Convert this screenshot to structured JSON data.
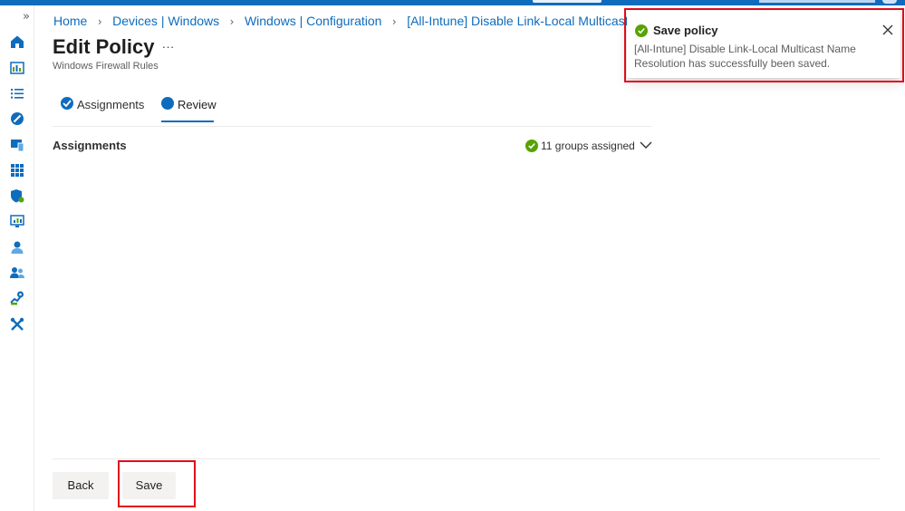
{
  "breadcrumb": {
    "items": [
      "Home",
      "Devices | Windows",
      "Windows | Configuration",
      "[All-Intune] Disable Link-Local Multicast Name Resolutio"
    ],
    "separator": ">"
  },
  "header": {
    "title": "Edit Policy",
    "more_label": "...",
    "subtitle": "Windows Firewall Rules"
  },
  "tabs": [
    {
      "label": "Assignments",
      "state": "completed"
    },
    {
      "label": "Review",
      "state": "current"
    }
  ],
  "review": {
    "section_label": "Assignments",
    "groups_status": "11 groups assigned"
  },
  "footer": {
    "back_label": "Back",
    "save_label": "Save"
  },
  "notification": {
    "title": "Save policy",
    "message": "[All-Intune] Disable Link-Local Multicast Name Resolution has successfully been saved."
  },
  "left_nav": {
    "collapse_icon": "double-chevron-right-icon",
    "icons": [
      "home-icon",
      "dashboard-icon",
      "all-services-icon",
      "devices-icon",
      "device-screen-icon",
      "apps-grid-icon",
      "endpoint-security-icon",
      "reports-icon",
      "users-icon",
      "groups-icon",
      "tenant-admin-icon",
      "troubleshooting-icon"
    ]
  },
  "colors": {
    "accent": "#0f6cbd",
    "success": "#57a300",
    "highlight": "#e00b1c",
    "text": "#323130",
    "muted_text": "#605e5c"
  }
}
